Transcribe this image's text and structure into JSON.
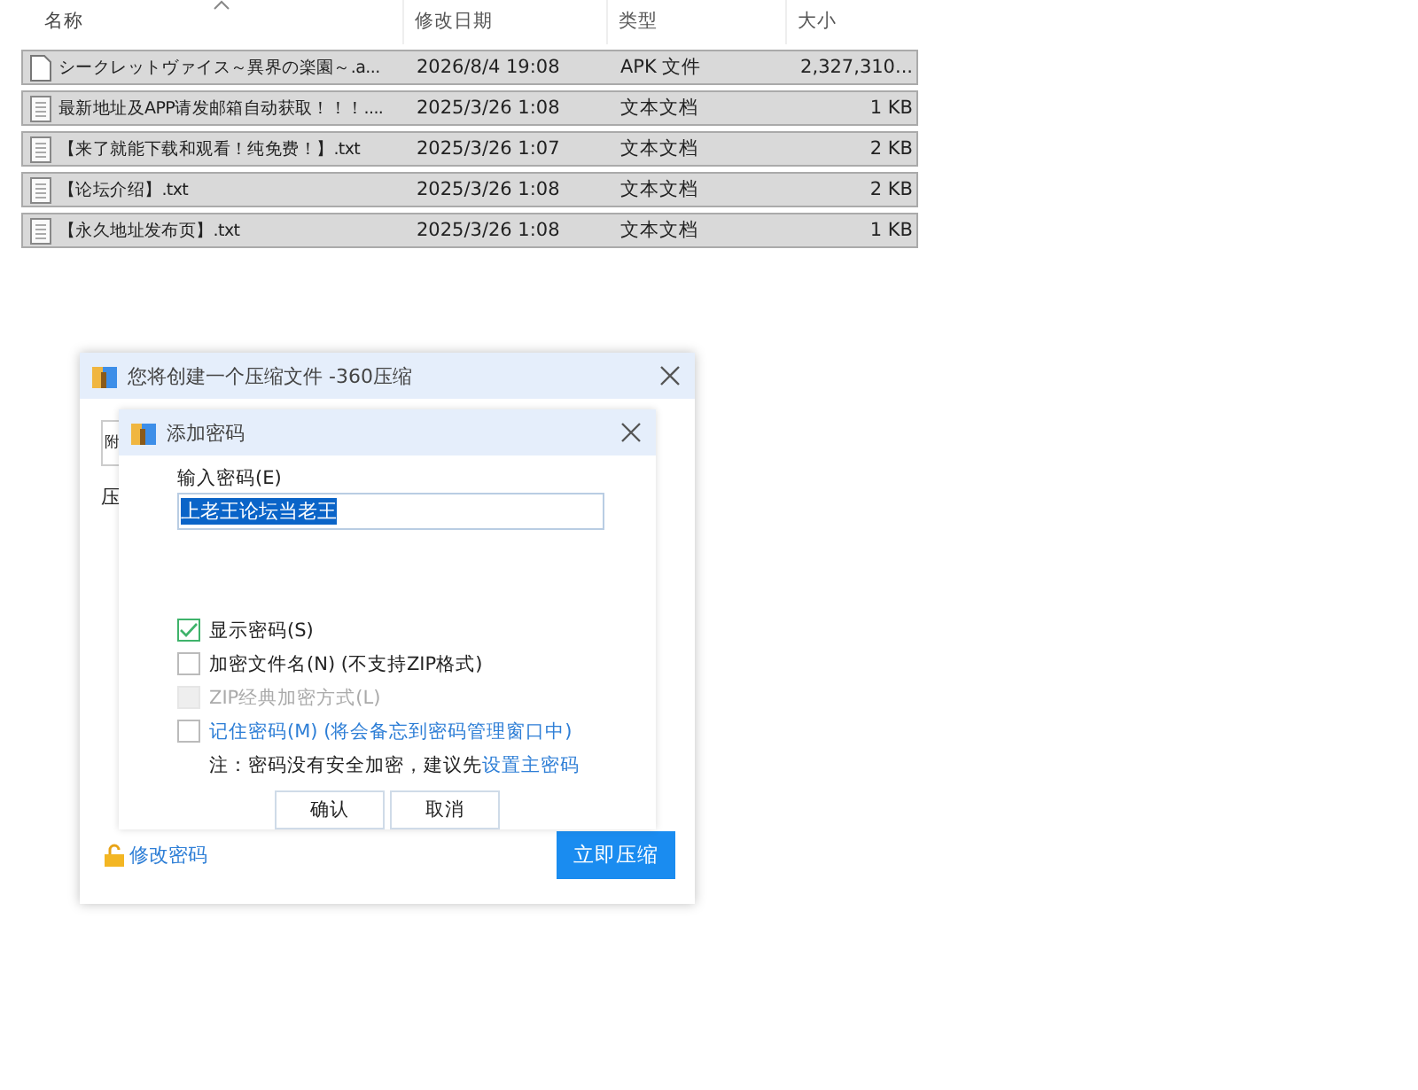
{
  "file_list": {
    "columns": [
      {
        "label": "名称",
        "sorted": true
      },
      {
        "label": "修改日期",
        "sorted": false
      },
      {
        "label": "类型",
        "sorted": false
      },
      {
        "label": "大小",
        "sorted": false
      }
    ],
    "rows": [
      {
        "name": "シークレットヴァイス～異界の楽園～.a...",
        "date": "2026/8/4 19:08",
        "type": "APK 文件",
        "size": "2,327,310...",
        "kind": "file",
        "selected": true
      },
      {
        "name": "最新地址及APP请发邮箱自动获取！！！....",
        "date": "2025/3/26 1:08",
        "type": "文本文档",
        "size": "1 KB",
        "kind": "text",
        "selected": true
      },
      {
        "name": "【来了就能下载和观看！纯免费！】.txt",
        "date": "2025/3/26 1:07",
        "type": "文本文档",
        "size": "2 KB",
        "kind": "text",
        "selected": true
      },
      {
        "name": "【论坛介绍】.txt",
        "date": "2025/3/26 1:08",
        "type": "文本文档",
        "size": "2 KB",
        "kind": "text",
        "selected": true
      },
      {
        "name": "【永久地址发布页】.txt",
        "date": "2025/3/26 1:08",
        "type": "文本文档",
        "size": "1 KB",
        "kind": "text",
        "selected": true
      }
    ]
  },
  "compress_dialog": {
    "title": "您将创建一个压缩文件 -360压缩",
    "field_fragment": "附",
    "label_fragment": "压",
    "change_password": "修改密码",
    "compress_button": "立即压缩"
  },
  "password_dialog": {
    "title": "添加密码",
    "password_label": "输入密码(E)",
    "password_value": "上老王论坛当老王",
    "options": [
      {
        "label": "显示密码(S)",
        "checked": true,
        "disabled": false,
        "kind": "plain"
      },
      {
        "label": "加密文件名(N) (不支持ZIP格式)",
        "checked": false,
        "disabled": false,
        "kind": "plain"
      },
      {
        "label": "ZIP经典加密方式(L)",
        "checked": false,
        "disabled": true,
        "kind": "plain"
      },
      {
        "label": "记住密码(M) (将会备忘到密码管理窗口中)",
        "checked": false,
        "disabled": false,
        "kind": "link"
      }
    ],
    "note": "注：密码没有安全加密，建议先",
    "note_link": "设置主密码",
    "buttons": [
      "确认",
      "取消"
    ]
  }
}
